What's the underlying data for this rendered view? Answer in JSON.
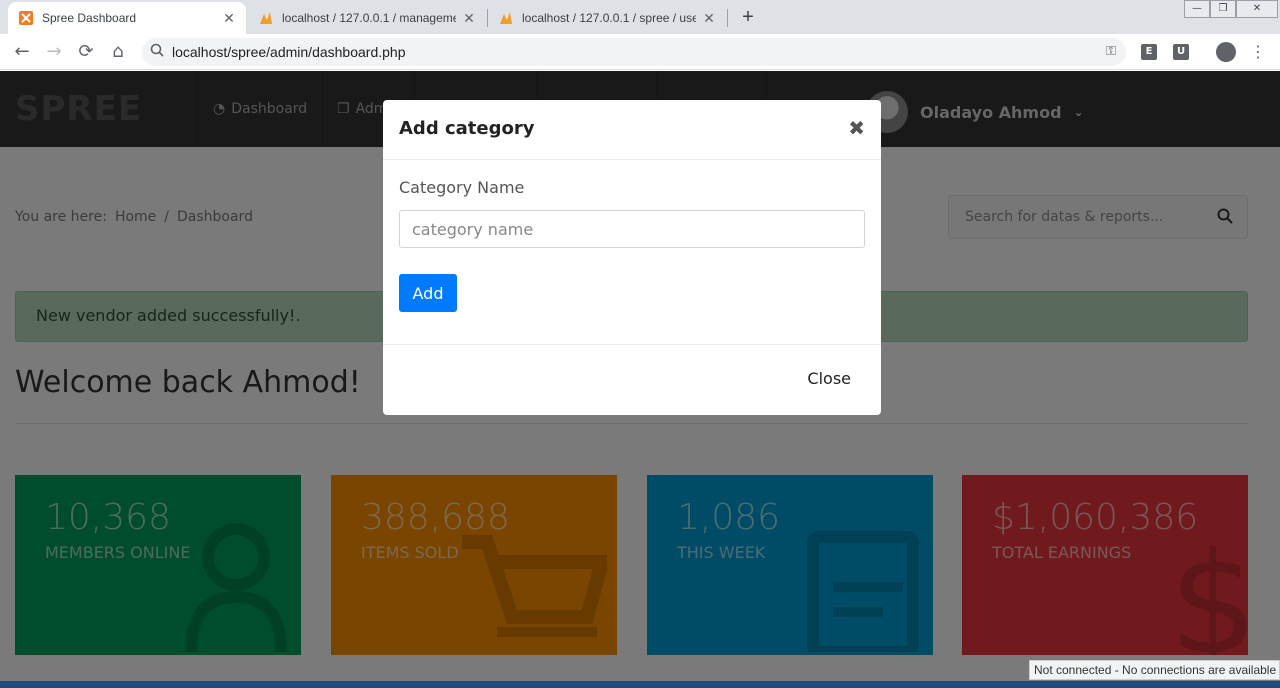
{
  "browser": {
    "tabs": [
      {
        "title": "Spree Dashboard",
        "active": true,
        "favicon": "xampp-icon"
      },
      {
        "title": "localhost / 127.0.0.1 / manageme",
        "active": false,
        "favicon": "phpmyadmin-icon"
      },
      {
        "title": "localhost / 127.0.0.1 / spree / use",
        "active": false,
        "favicon": "phpmyadmin-icon"
      }
    ],
    "url": "localhost/spree/admin/dashboard.php",
    "extensions": [
      "E",
      "U"
    ]
  },
  "site": {
    "logo": "SPREE",
    "nav": [
      {
        "label": "Dashboard",
        "icon": "dashboard-icon"
      },
      {
        "label": "Adm",
        "icon": "copy-icon"
      }
    ],
    "user_name": "Oladayo Ahmod"
  },
  "breadcrumb": {
    "prefix": "You are here:",
    "items": [
      "Home",
      "/",
      "Dashboard"
    ]
  },
  "search": {
    "placeholder": "Search for datas & reports..."
  },
  "alert": {
    "message": "New vendor added successfully!."
  },
  "welcome": "Welcome back Ahmod!",
  "stats": [
    {
      "value": "10,368",
      "label": "MEMBERS ONLINE",
      "color": "#009a5b",
      "icon": "user-icon"
    },
    {
      "value": "388,688",
      "label": "ITEMS SOLD",
      "color": "#f28b00",
      "icon": "cart-icon"
    },
    {
      "value": "1,086",
      "label": "THIS WEEK",
      "color": "#0099cc",
      "icon": "calendar-icon"
    },
    {
      "value": "$1,060,386",
      "label": "TOTAL EARNINGS",
      "color": "#e0353d",
      "icon": "dollar-icon"
    }
  ],
  "modal": {
    "title": "Add category",
    "field_label": "Category Name",
    "field_placeholder": "category name",
    "field_value": "",
    "add_label": "Add",
    "close_label": "Close"
  },
  "status_bubble": "Not connected - No connections are available"
}
